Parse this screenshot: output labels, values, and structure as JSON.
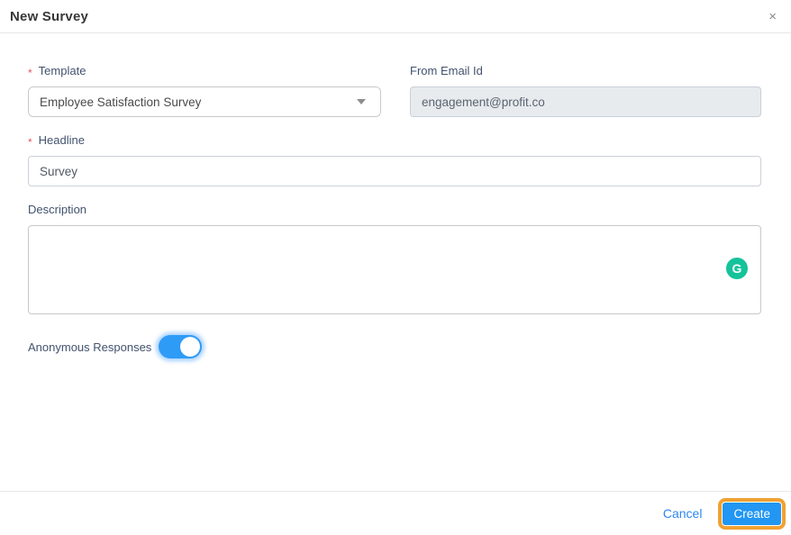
{
  "dialog": {
    "title": "New Survey",
    "close_icon": "×"
  },
  "fields": {
    "template": {
      "label": "Template",
      "required_marker": "*",
      "value": "Employee Satisfaction Survey"
    },
    "from_email": {
      "label": "From Email Id",
      "value": "engagement@profit.co",
      "disabled": true
    },
    "headline": {
      "label": "Headline",
      "required_marker": "*",
      "value": "Survey"
    },
    "description": {
      "label": "Description",
      "value": ""
    },
    "anonymous_responses": {
      "label": "Anonymous Responses",
      "state": "on"
    }
  },
  "icons": {
    "grammarly_letter": "G"
  },
  "footer": {
    "cancel_label": "Cancel",
    "create_label": "Create"
  },
  "colors": {
    "accent_blue": "#2196f3",
    "toggle_blue": "#2e9bf7",
    "link_blue": "#2e86f0",
    "highlight_orange": "#f0a132",
    "grammarly_green": "#15c39a",
    "required_red": "#e25563",
    "label_slate": "#42526e"
  }
}
